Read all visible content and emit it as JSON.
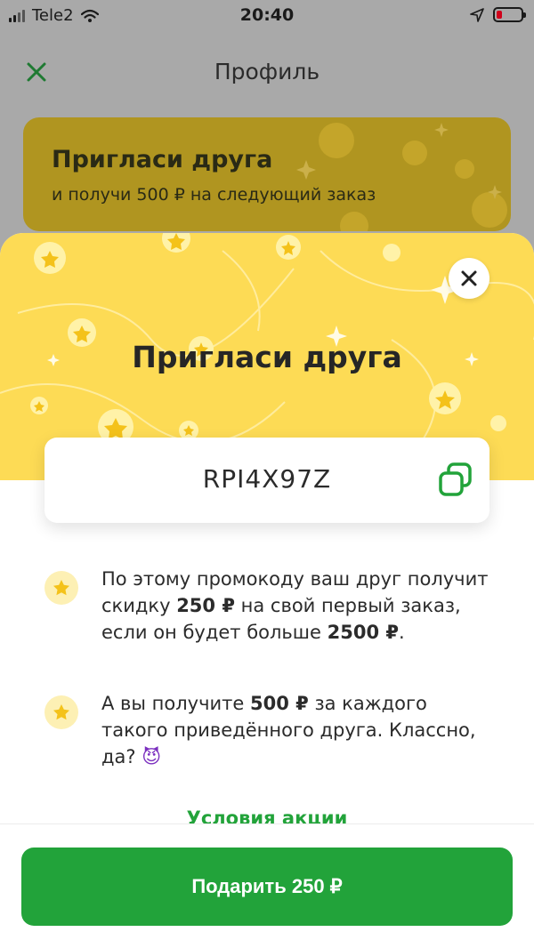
{
  "status_bar": {
    "carrier": "Tele2",
    "time": "20:40"
  },
  "nav": {
    "title": "Профиль",
    "close_icon": "close-icon"
  },
  "promo_card": {
    "title": "Пригласи друга",
    "subtitle": "и получи 500 ₽ на следующий заказ"
  },
  "sheet": {
    "title": "Пригласи друга",
    "promo_code": "RPI4X97Z",
    "info_items": [
      {
        "parts": [
          "По этому промокоду ваш друг получит скидку ",
          "250 ₽",
          " на свой первый заказ, если он будет больше ",
          "2500 ₽",
          "."
        ]
      },
      {
        "parts": [
          "А вы получите ",
          "500 ₽",
          " за каждого такого приведённого друга. Классно, да? ",
          "😈"
        ]
      }
    ],
    "terms_link": "Условия акции",
    "gift_button": "Подарить 250 ₽"
  },
  "colors": {
    "accent_green": "#22a33a",
    "hero_yellow": "#fddb55",
    "bullet_bg": "#fdf0b4",
    "star_yellow": "#f4c21a"
  }
}
